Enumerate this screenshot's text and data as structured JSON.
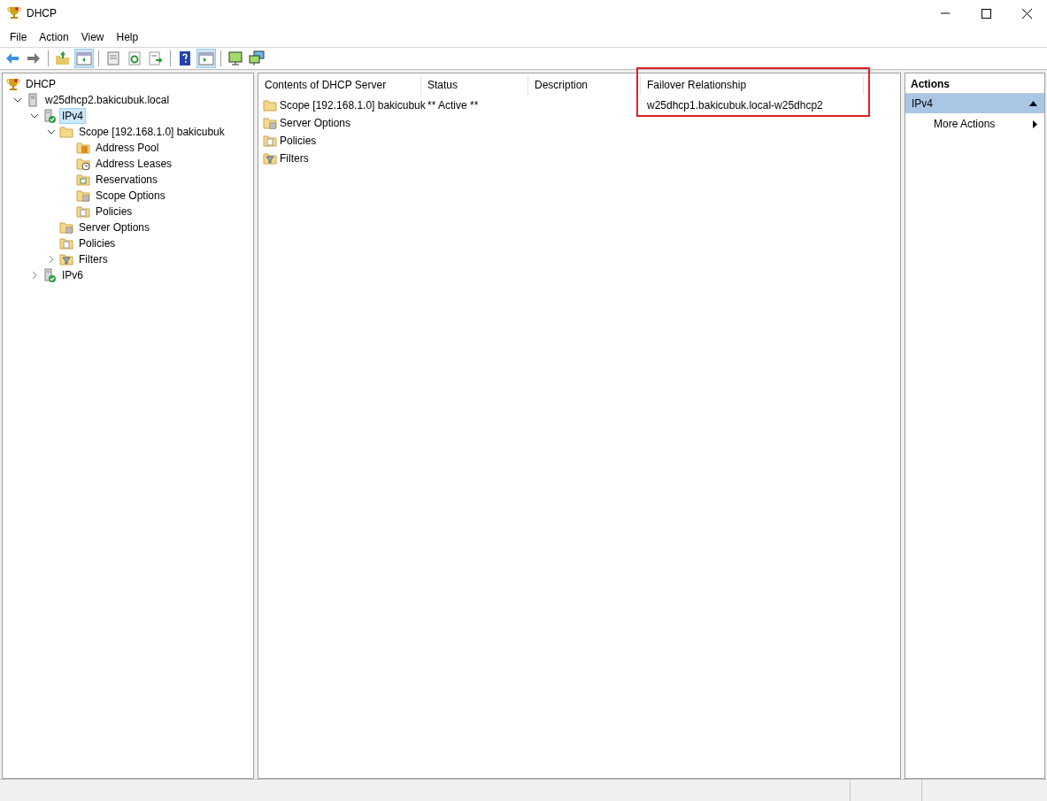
{
  "window": {
    "title": "DHCP"
  },
  "menu": [
    "File",
    "Action",
    "View",
    "Help"
  ],
  "toolbar": [
    {
      "kind": "back"
    },
    {
      "kind": "forward"
    },
    {
      "kind": "separator"
    },
    {
      "kind": "up",
      "pressed": false
    },
    {
      "kind": "tree",
      "pressed": true
    },
    {
      "kind": "separator"
    },
    {
      "kind": "properties",
      "pressed": false
    },
    {
      "kind": "refresh",
      "pressed": false
    },
    {
      "kind": "export",
      "pressed": false
    },
    {
      "kind": "separator"
    },
    {
      "kind": "help",
      "pressed": false
    },
    {
      "kind": "actionpane",
      "pressed": true
    },
    {
      "kind": "separator"
    },
    {
      "kind": "monitor",
      "pressed": false
    },
    {
      "kind": "monitors",
      "pressed": false
    }
  ],
  "tree": [
    {
      "label": "DHCP",
      "kind": "dhcp",
      "selected": false,
      "children": [
        {
          "label": "w25dhcp2.bakicubuk.local",
          "kind": "server",
          "expanded": true,
          "selected": false,
          "children": [
            {
              "label": "IPv4",
              "kind": "ipserver",
              "expanded": true,
              "selected": true,
              "children": [
                {
                  "label": "Scope [192.168.1.0] bakicubuk",
                  "kind": "folder",
                  "expanded": true,
                  "selected": false,
                  "children": [
                    {
                      "label": "Address Pool",
                      "kind": "pool",
                      "selected": false
                    },
                    {
                      "label": "Address Leases",
                      "kind": "leases",
                      "selected": false
                    },
                    {
                      "label": "Reservations",
                      "kind": "reservations",
                      "selected": false
                    },
                    {
                      "label": "Scope Options",
                      "kind": "options",
                      "selected": false
                    },
                    {
                      "label": "Policies",
                      "kind": "policies",
                      "selected": false
                    }
                  ]
                },
                {
                  "label": "Server Options",
                  "kind": "options",
                  "selected": false
                },
                {
                  "label": "Policies",
                  "kind": "policies",
                  "selected": false
                },
                {
                  "label": "Filters",
                  "kind": "filters",
                  "expanded": false,
                  "selected": false
                }
              ]
            },
            {
              "label": "IPv6",
              "kind": "ipserver",
              "expanded": false,
              "selected": false
            }
          ]
        }
      ]
    }
  ],
  "list": {
    "columns": [
      {
        "label": "Contents of DHCP Server",
        "highlighted": false
      },
      {
        "label": "Status",
        "highlighted": false
      },
      {
        "label": "Description",
        "highlighted": false
      },
      {
        "label": "Failover Relationship",
        "highlighted": true
      }
    ],
    "rows": [
      {
        "kind": "folder",
        "cells": [
          "Scope [192.168.1.0] bakicubuk",
          "** Active **",
          "",
          "w25dhcp1.bakicubuk.local-w25dhcp2"
        ]
      },
      {
        "kind": "options",
        "cells": [
          "Server Options"
        ]
      },
      {
        "kind": "policies",
        "cells": [
          "Policies"
        ]
      },
      {
        "kind": "filters",
        "cells": [
          "Filters"
        ]
      }
    ]
  },
  "actions": {
    "title": "Actions",
    "sections": [
      {
        "label": "IPv4",
        "expanded": true,
        "items": [
          {
            "label": "More Actions",
            "submenu": true
          }
        ]
      }
    ]
  }
}
